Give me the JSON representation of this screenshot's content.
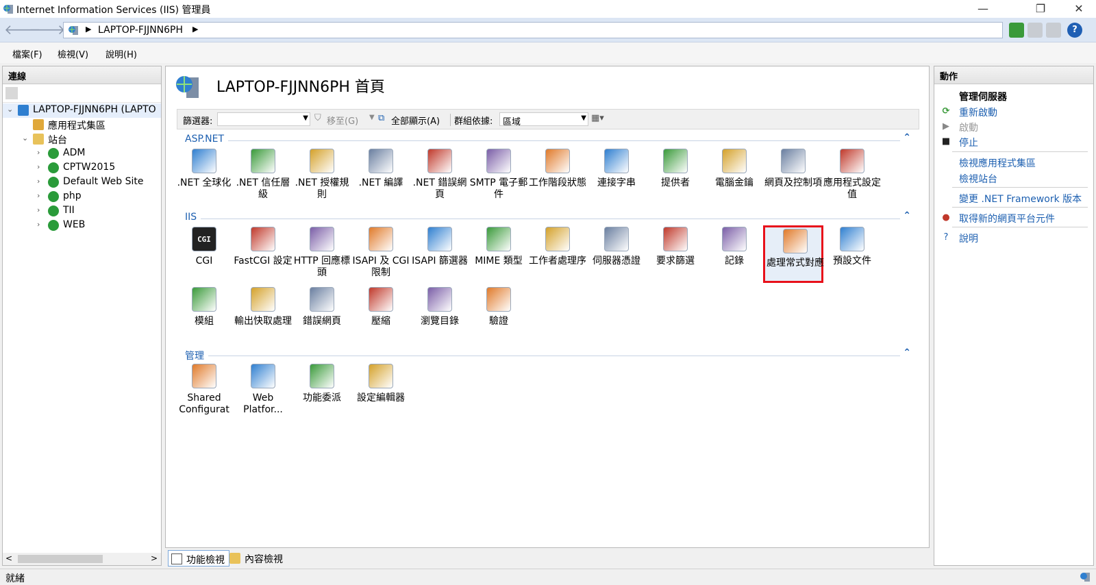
{
  "window": {
    "title": "Internet Information Services (IIS) 管理員"
  },
  "address": {
    "breadcrumb": "LAPTOP-FJJNN6PH"
  },
  "menu": [
    "檔案(F)",
    "檢視(V)",
    "說明(H)"
  ],
  "connections": {
    "header": "連線",
    "tree": [
      {
        "label": "LAPTOP-FJJNN6PH (LAPTO",
        "depth": 0,
        "expand": "v",
        "icon": "server-icon"
      },
      {
        "label": "應用程式集區",
        "depth": 1,
        "expand": "",
        "icon": "app-pool-icon"
      },
      {
        "label": "站台",
        "depth": 1,
        "expand": "v",
        "icon": "sites-folder-icon"
      },
      {
        "label": "ADM",
        "depth": 2,
        "expand": ">",
        "icon": "website-icon"
      },
      {
        "label": "CPTW2015",
        "depth": 2,
        "expand": ">",
        "icon": "website-icon"
      },
      {
        "label": "Default Web Site",
        "depth": 2,
        "expand": ">",
        "icon": "website-icon"
      },
      {
        "label": "php",
        "depth": 2,
        "expand": ">",
        "icon": "website-icon"
      },
      {
        "label": "TII",
        "depth": 2,
        "expand": ">",
        "icon": "website-icon"
      },
      {
        "label": "WEB",
        "depth": 2,
        "expand": ">",
        "icon": "website-icon"
      }
    ]
  },
  "home": {
    "title": "LAPTOP-FJJNN6PH 首頁",
    "filter": {
      "label": "篩選器:",
      "goto": "移至(G)",
      "showall": "全部顯示(A)",
      "groupby_label": "群組依據:",
      "groupby_value": "區域"
    },
    "sections": [
      {
        "name": "ASP.NET",
        "features": [
          {
            "label": ".NET 全球化",
            "icon": "globe-icon"
          },
          {
            "label": ".NET 信任層級",
            "icon": "trust-level-icon"
          },
          {
            "label": ".NET 授權規則",
            "icon": "authorization-lock-icon"
          },
          {
            "label": ".NET 編譯",
            "icon": "compilation-icon"
          },
          {
            "label": ".NET 錯誤網頁",
            "icon": "error-page-404-icon"
          },
          {
            "label": "SMTP 電子郵件",
            "icon": "smtp-mail-icon"
          },
          {
            "label": "工作階段狀態",
            "icon": "session-state-icon"
          },
          {
            "label": "連接字串",
            "icon": "connection-string-icon"
          },
          {
            "label": "提供者",
            "icon": "providers-icon"
          },
          {
            "label": "電腦金鑰",
            "icon": "machine-key-icon"
          },
          {
            "label": "網頁及控制項",
            "icon": "pages-controls-icon"
          },
          {
            "label": "應用程式設定值",
            "icon": "app-settings-icon"
          }
        ]
      },
      {
        "name": "IIS",
        "features": [
          {
            "label": "CGI",
            "icon": "cgi-icon"
          },
          {
            "label": "FastCGI 設定",
            "icon": "fastcgi-icon"
          },
          {
            "label": "HTTP 回應標頭",
            "icon": "http-headers-icon"
          },
          {
            "label": "ISAPI 及 CGI 限制",
            "icon": "isapi-cgi-icon"
          },
          {
            "label": "ISAPI 篩選器",
            "icon": "isapi-filter-icon"
          },
          {
            "label": "MIME 類型",
            "icon": "mime-icon"
          },
          {
            "label": "工作者處理序",
            "icon": "worker-process-icon"
          },
          {
            "label": "伺服器憑證",
            "icon": "server-cert-icon"
          },
          {
            "label": "要求篩選",
            "icon": "request-filter-icon"
          },
          {
            "label": "記錄",
            "icon": "logging-icon"
          },
          {
            "label": "處理常式對應",
            "icon": "handler-mapping-icon",
            "highlight": true
          },
          {
            "label": "預設文件",
            "icon": "default-document-icon"
          },
          {
            "label": "模組",
            "icon": "modules-icon"
          },
          {
            "label": "輸出快取處理",
            "icon": "output-cache-icon"
          },
          {
            "label": "錯誤網頁",
            "icon": "error-page-icon"
          },
          {
            "label": "壓縮",
            "icon": "compression-icon"
          },
          {
            "label": "瀏覽目錄",
            "icon": "directory-browse-icon"
          },
          {
            "label": "驗證",
            "icon": "authentication-icon"
          }
        ]
      },
      {
        "name": "管理",
        "features": [
          {
            "label": "Shared Configurat",
            "icon": "shared-config-icon"
          },
          {
            "label": "Web Platfor...",
            "icon": "web-platform-icon"
          },
          {
            "label": "功能委派",
            "icon": "feature-delegation-icon"
          },
          {
            "label": "設定編輯器",
            "icon": "config-editor-icon"
          }
        ]
      }
    ]
  },
  "bottom_tabs": [
    "功能檢視",
    "內容檢視"
  ],
  "actions": {
    "header": "動作",
    "group_title": "管理伺服器",
    "items": [
      {
        "label": "重新啟動",
        "icon": "restart-icon",
        "enabled": true
      },
      {
        "label": "啟動",
        "icon": "start-icon",
        "enabled": false
      },
      {
        "label": "停止",
        "icon": "stop-icon",
        "enabled": true
      },
      {
        "label": "檢視應用程式集區",
        "icon": "",
        "enabled": true
      },
      {
        "label": "檢視站台",
        "icon": "",
        "enabled": true
      },
      {
        "label": "變更 .NET Framework 版本",
        "icon": "",
        "enabled": true
      },
      {
        "label": "取得新的網頁平台元件",
        "icon": "web-platform-small-icon",
        "enabled": true
      },
      {
        "label": "說明",
        "icon": "help-icon",
        "enabled": true
      }
    ]
  },
  "status": {
    "text": "就緒"
  },
  "colors": {
    "accent": "#1c5fb0",
    "highlight": "#e8101a",
    "addressbar": "#dce6f4"
  }
}
